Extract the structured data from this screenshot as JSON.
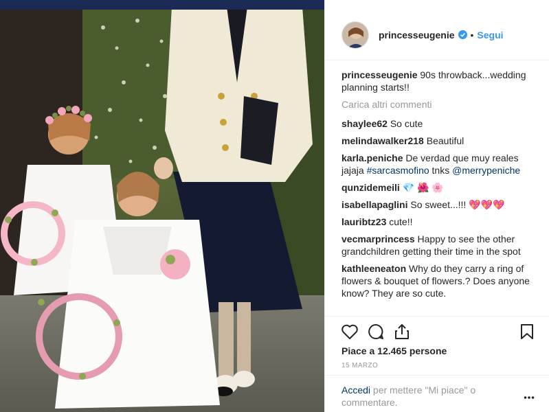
{
  "header": {
    "username": "princesseugenie",
    "separator": "•",
    "follow_label": "Segui"
  },
  "caption": {
    "username": "princesseugenie",
    "text": "90s throwback...wedding planning starts!!"
  },
  "load_more_label": "Carica altri commenti",
  "comments": [
    {
      "username": "shaylee62",
      "parts": [
        {
          "t": "So cute"
        }
      ]
    },
    {
      "username": "melindawalker218",
      "parts": [
        {
          "t": "Beautiful"
        }
      ]
    },
    {
      "username": "karla.peniche",
      "parts": [
        {
          "t": "De verdad que muy reales jajaja "
        },
        {
          "t": "#sarcasmofino",
          "tag": true
        },
        {
          "t": " tnks "
        },
        {
          "t": "@merrypeniche",
          "tag": true
        }
      ]
    },
    {
      "username": "qunzidemeili",
      "parts": [
        {
          "t": "💎 🌺 🌸"
        }
      ]
    },
    {
      "username": "isabellapaglini",
      "parts": [
        {
          "t": "So sweet...!!! 💖💖💖"
        }
      ]
    },
    {
      "username": "lauribtz23",
      "parts": [
        {
          "t": "cute!!"
        }
      ]
    },
    {
      "username": "vecmarprincess",
      "parts": [
        {
          "t": "Happy to see the other grandchildren getting their time in the spot"
        }
      ]
    },
    {
      "username": "kathleeneaton",
      "parts": [
        {
          "t": "Why do they carry a ring of flowers & bouquet of flowers.? Does anyone know? They are so cute."
        }
      ]
    }
  ],
  "actions": {
    "like_icon": "heart-icon",
    "comment_icon": "comment-icon",
    "share_icon": "share-icon",
    "save_icon": "bookmark-icon"
  },
  "likes_text": "Piace a 12.465 persone",
  "date_text": "15 marzo",
  "login": {
    "link_text": "Accedi",
    "rest_text": " per mettere \"Mi piace\" o commentare."
  },
  "colors": {
    "link_blue": "#3897f0",
    "tag_blue": "#003569",
    "muted": "#999999",
    "text": "#262626"
  }
}
